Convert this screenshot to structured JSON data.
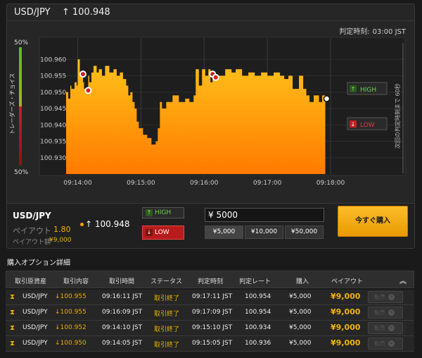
{
  "header": {
    "pair": "USD/JPY",
    "price_arrow": "↑",
    "price": "100.948"
  },
  "expiry": {
    "label": "判定時刻:",
    "time": "03:00 JST"
  },
  "chart": {
    "tc_top": "50%",
    "tc_bottom": "50%",
    "tc_label": "トレーダーズ・チョイス",
    "countdown_label": "次回の判定時刻まで 60秒",
    "high_label": "HIGH",
    "low_label": "LOW"
  },
  "chart_data": {
    "type": "area",
    "y_ticks": [
      "100.960",
      "100.955",
      "100.950",
      "100.945",
      "100.940",
      "100.935",
      "100.930"
    ],
    "ylim": [
      100.925,
      100.965
    ],
    "x_ticks": [
      "09:14:00",
      "09:15:00",
      "09:16:00",
      "09:17:00",
      "09:18:00"
    ],
    "series": [
      {
        "x": [
          "09:13:49",
          "09:13:51",
          "09:13:53",
          "09:13:54",
          "09:13:57",
          "09:13:59",
          "09:14:00",
          "09:14:02",
          "09:14:04",
          "09:14:05",
          "09:14:06",
          "09:14:08",
          "09:14:10",
          "09:14:11",
          "09:14:13",
          "09:14:15",
          "09:14:18",
          "09:14:20",
          "09:14:23",
          "09:14:26",
          "09:14:30",
          "09:14:34",
          "09:14:37",
          "09:14:40",
          "09:14:43",
          "09:14:46",
          "09:14:48",
          "09:14:50",
          "09:14:52",
          "09:14:54",
          "09:14:56",
          "09:14:58",
          "09:15:02",
          "09:15:06",
          "09:15:10",
          "09:15:14",
          "09:15:16",
          "09:15:18",
          "09:15:20",
          "09:15:24",
          "09:15:30",
          "09:15:36",
          "09:15:42",
          "09:15:46",
          "09:15:50",
          "09:15:52",
          "09:15:55",
          "09:15:58",
          "09:16:01",
          "09:16:04",
          "09:16:06",
          "09:16:08",
          "09:16:10",
          "09:16:14",
          "09:16:20",
          "09:16:26",
          "09:16:30",
          "09:16:36",
          "09:16:42",
          "09:16:48",
          "09:16:54",
          "09:17:00",
          "09:17:06",
          "09:17:12",
          "09:17:16",
          "09:17:20",
          "09:17:24",
          "09:17:30",
          "09:17:34",
          "09:17:37",
          "09:17:40",
          "09:17:44",
          "09:17:49",
          "09:17:52",
          "09:17:55"
        ],
        "values": [
          100.95,
          100.948,
          100.952,
          100.951,
          100.953,
          100.952,
          100.96,
          100.955,
          100.956,
          100.953,
          100.951,
          100.95,
          100.955,
          100.953,
          100.956,
          100.958,
          100.956,
          100.957,
          100.955,
          100.958,
          100.956,
          100.957,
          100.955,
          100.956,
          100.954,
          100.952,
          100.949,
          100.95,
          100.947,
          100.945,
          100.941,
          100.939,
          100.937,
          100.936,
          100.934,
          100.935,
          100.939,
          100.947,
          100.945,
          100.947,
          100.949,
          100.947,
          100.948,
          100.947,
          100.949,
          100.957,
          100.952,
          100.957,
          100.955,
          100.957,
          100.953,
          100.954,
          100.954,
          100.955,
          100.957,
          100.956,
          100.957,
          100.955,
          100.956,
          100.955,
          100.956,
          100.955,
          100.956,
          100.955,
          100.954,
          100.955,
          100.951,
          100.955,
          100.951,
          100.949,
          100.947,
          100.949,
          100.947,
          100.949,
          100.948
        ]
      }
    ],
    "markers": [
      {
        "x": "09:14:05",
        "value": 100.9555
      },
      {
        "x": "09:14:10",
        "value": 100.9505
      },
      {
        "x": "09:16:08",
        "value": 100.9555
      },
      {
        "x": "09:16:11",
        "value": 100.9545
      }
    ],
    "current": {
      "x": "09:17:55",
      "value": 100.948
    }
  },
  "trade": {
    "pair": "USD/JPY",
    "payout_label": "ペイアウト",
    "payout_rate": "1.80",
    "payout_amount_label": "ペイアウト額",
    "payout_amount": "¥9,000",
    "price_arrow": "↑",
    "price": "100.948",
    "high_label": "HIGH",
    "low_label": "LOW",
    "amount": "¥ 5000",
    "presets": [
      "¥5,000",
      "¥10,000",
      "¥50,000"
    ],
    "buy_label": "今すぐ購入"
  },
  "details": {
    "title": "購入オプション詳細",
    "headers": [
      "取引原資産",
      "取引内容",
      "取引時間",
      "ステータス",
      "判定時刻",
      "判定レート",
      "購入",
      "ペイアウト"
    ],
    "sell_label": "転売",
    "rows": [
      {
        "asset": "USD/JPY",
        "content": "100.955",
        "trade_time": "09:16:11 JST",
        "status": "取引終了",
        "expiry": "09:17:11 JST",
        "rate": "100.954",
        "amount": "¥5,000",
        "payout": "¥9,000"
      },
      {
        "asset": "USD/JPY",
        "content": "100.955",
        "trade_time": "09:16:09 JST",
        "status": "取引終了",
        "expiry": "09:17:09 JST",
        "rate": "100.954",
        "amount": "¥5,000",
        "payout": "¥9,000"
      },
      {
        "asset": "USD/JPY",
        "content": "100.952",
        "trade_time": "09:14:10 JST",
        "status": "取引終了",
        "expiry": "09:15:10 JST",
        "rate": "100.934",
        "amount": "¥5,000",
        "payout": "¥9,000"
      },
      {
        "asset": "USD/JPY",
        "content": "100.950",
        "trade_time": "09:14:05 JST",
        "status": "取引終了",
        "expiry": "09:15:05 JST",
        "rate": "100.936",
        "amount": "¥5,000",
        "payout": "¥9,000"
      }
    ]
  },
  "colors": {
    "accent": "#e8b100",
    "chart_fill_top": "#ffc21a",
    "chart_fill_bottom": "#ff7a00",
    "high": "#6bd44b",
    "low": "#e32626",
    "buy_button": "#f5a300"
  }
}
